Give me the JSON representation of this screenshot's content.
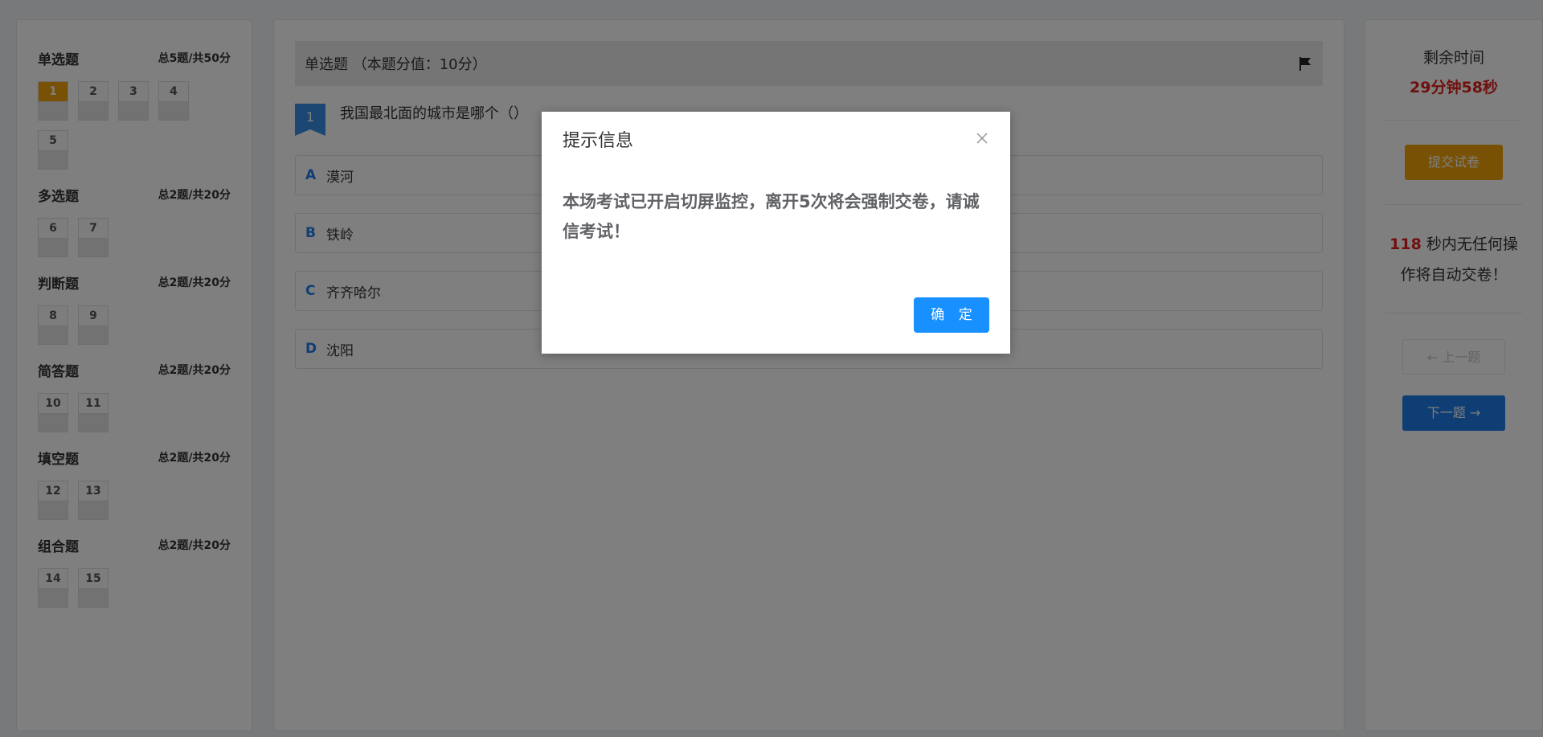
{
  "sections": [
    {
      "title": "单选题",
      "meta": "总5题/共50分",
      "questions": [
        "1",
        "2",
        "3",
        "4",
        "5"
      ],
      "current": "1"
    },
    {
      "title": "多选题",
      "meta": "总2题/共20分",
      "questions": [
        "6",
        "7"
      ]
    },
    {
      "title": "判断题",
      "meta": "总2题/共20分",
      "questions": [
        "8",
        "9"
      ]
    },
    {
      "title": "简答题",
      "meta": "总2题/共20分",
      "questions": [
        "10",
        "11"
      ]
    },
    {
      "title": "填空题",
      "meta": "总2题/共20分",
      "questions": [
        "12",
        "13"
      ]
    },
    {
      "title": "组合题",
      "meta": "总2题/共20分",
      "questions": [
        "14",
        "15"
      ]
    }
  ],
  "question": {
    "header": "单选题 （本题分值：10分）",
    "number": "1",
    "stem": "我国最北面的城市是哪个（）",
    "options": [
      {
        "letter": "A",
        "text": "漠河"
      },
      {
        "letter": "B",
        "text": "铁岭"
      },
      {
        "letter": "C",
        "text": "齐齐哈尔"
      },
      {
        "letter": "D",
        "text": "沈阳"
      }
    ]
  },
  "sidebar": {
    "remain_label": "剩余时间",
    "remain_value": "29分钟58秒",
    "submit_label": "提交试卷",
    "idle_seconds": "118",
    "idle_text": " 秒内无任何操作将自动交卷！",
    "prev_label": "← 上一题",
    "next_label": "下一题 →"
  },
  "dialog": {
    "title": "提示信息",
    "message": "本场考试已开启切屏监控，离开5次将会强制交卷，请诚信考试！",
    "ok_label": "确 定"
  },
  "colors": {
    "accent": "#1e7ce8",
    "warning": "#f0a30a",
    "danger": "#e0201a"
  }
}
